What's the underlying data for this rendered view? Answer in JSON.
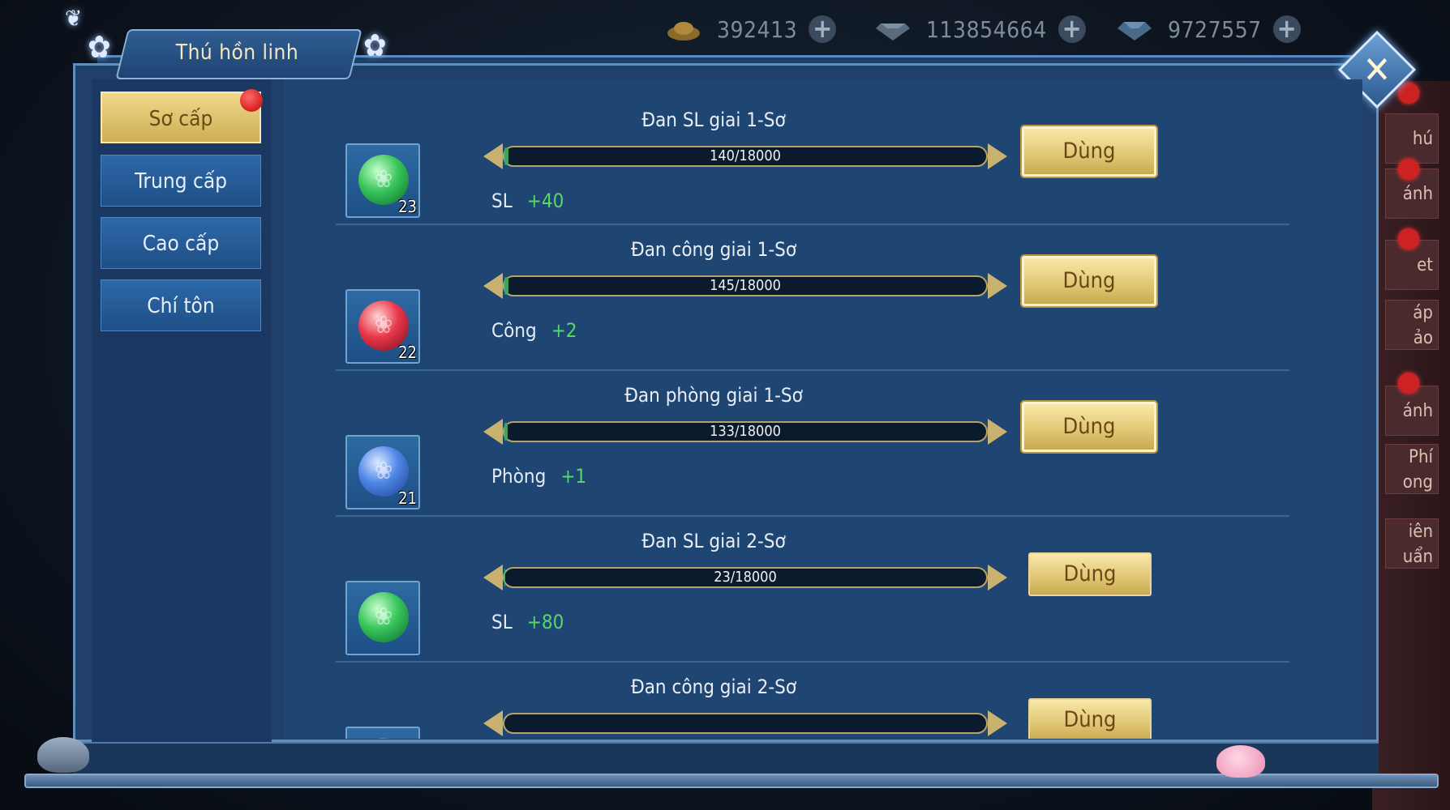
{
  "resources": [
    {
      "value": "392413",
      "icon": "gold-ingot-icon",
      "plus": "+"
    },
    {
      "value": "113854664",
      "icon": "diamond-icon",
      "plus": "+"
    },
    {
      "value": "9727557",
      "icon": "blue-gem-icon",
      "plus": "+"
    }
  ],
  "window": {
    "title": "Thú hồn linh",
    "close": "✕"
  },
  "tabs": [
    {
      "label": "Sơ cấp",
      "active": true
    },
    {
      "label": "Trung cấp",
      "active": false
    },
    {
      "label": "Cao cấp",
      "active": false
    },
    {
      "label": "Chí tôn",
      "active": false
    }
  ],
  "items": [
    {
      "name": "Đan SL giai 1-Sơ",
      "progress": "140/18000",
      "current": 140,
      "max": 18000,
      "stat_label": "SL",
      "stat_value": "+40",
      "count": "23",
      "color": "green",
      "button": "Dùng"
    },
    {
      "name": "Đan công giai 1-Sơ",
      "progress": "145/18000",
      "current": 145,
      "max": 18000,
      "stat_label": "Công",
      "stat_value": "+2",
      "count": "22",
      "color": "red",
      "button": "Dùng"
    },
    {
      "name": "Đan phòng giai 1-Sơ",
      "progress": "133/18000",
      "current": 133,
      "max": 18000,
      "stat_label": "Phòng",
      "stat_value": "+1",
      "count": "21",
      "color": "blue",
      "button": "Dùng"
    },
    {
      "name": "Đan SL giai 2-Sơ",
      "progress": "23/18000",
      "current": 23,
      "max": 18000,
      "stat_label": "SL",
      "stat_value": "+80",
      "count": "",
      "color": "green",
      "button": "Dùng"
    },
    {
      "name": "Đan công giai 2-Sơ",
      "progress": "",
      "current": 0,
      "max": 18000,
      "stat_label": "",
      "stat_value": "",
      "count": "",
      "color": "red",
      "button": "Dùng"
    }
  ],
  "side_menu": [
    "hú",
    "ánh",
    "et",
    "áp",
    "ảo",
    "ánh",
    "Phí",
    "ong",
    "iên",
    "uẩn"
  ],
  "colors": {
    "accent_gold": "#e2c877",
    "panel_blue": "#20406a",
    "stat_green": "#57d66a"
  }
}
